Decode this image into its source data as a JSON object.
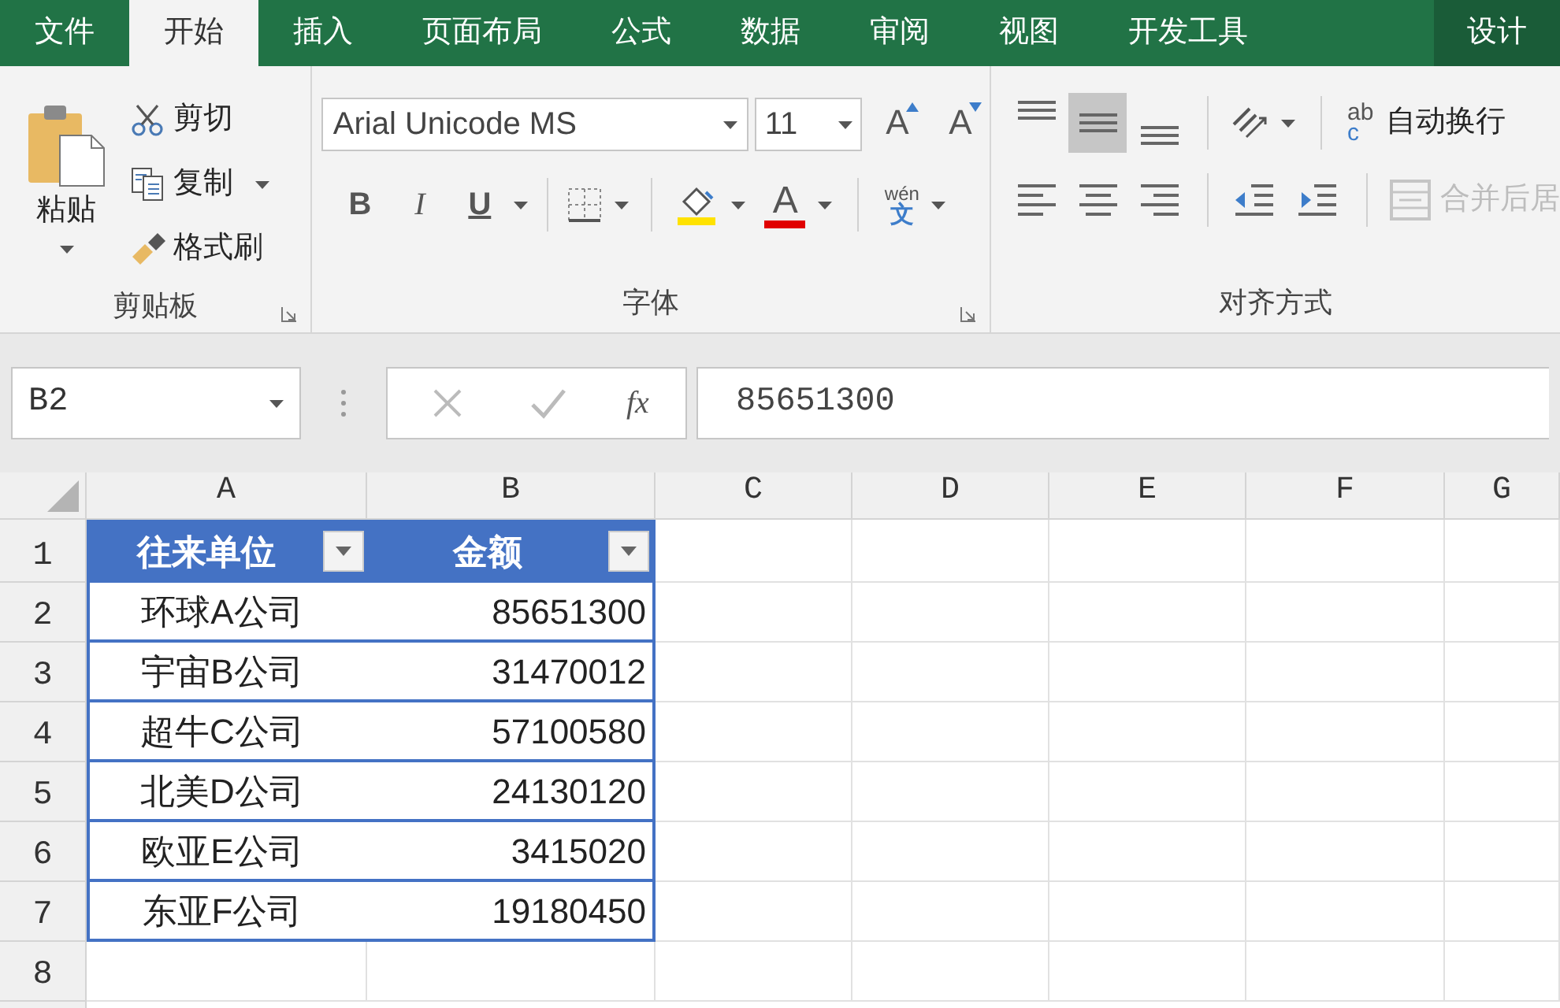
{
  "tabs": [
    {
      "label": "文件",
      "selected": false,
      "kind": "standard"
    },
    {
      "label": "开始",
      "selected": true,
      "kind": "standard"
    },
    {
      "label": "插入",
      "selected": false,
      "kind": "standard"
    },
    {
      "label": "页面布局",
      "selected": false,
      "kind": "standard"
    },
    {
      "label": "公式",
      "selected": false,
      "kind": "standard"
    },
    {
      "label": "数据",
      "selected": false,
      "kind": "standard"
    },
    {
      "label": "审阅",
      "selected": false,
      "kind": "standard"
    },
    {
      "label": "视图",
      "selected": false,
      "kind": "standard"
    },
    {
      "label": "开发工具",
      "selected": false,
      "kind": "standard"
    },
    {
      "label": "设计",
      "selected": false,
      "kind": "contextual"
    }
  ],
  "clipboard": {
    "paste": "粘贴",
    "commands": [
      {
        "label": "剪切",
        "kind": "cut"
      },
      {
        "label": "复制",
        "kind": "copy"
      },
      {
        "label": "格式刷",
        "kind": "painter"
      }
    ],
    "group_label": "剪贴板"
  },
  "font": {
    "font_name": "Arial Unicode MS",
    "font_size": "11",
    "grow_label": "A",
    "shrink_label": "A",
    "styles": [
      {
        "label": "B",
        "kind": "bold"
      },
      {
        "label": "I",
        "kind": "italic"
      },
      {
        "label": "U",
        "kind": "underline"
      }
    ],
    "font_color_label": "A",
    "phonetic_top": "wén",
    "phonetic_bottom": "文",
    "group_label": "字体"
  },
  "alignment": {
    "vertical": [
      {
        "kind": "top",
        "selected": false
      },
      {
        "kind": "middle",
        "selected": true
      },
      {
        "kind": "bottom",
        "selected": false
      }
    ],
    "horizontal": [
      {
        "kind": "left",
        "selected": false
      },
      {
        "kind": "center",
        "selected": false
      },
      {
        "kind": "right",
        "selected": false
      }
    ],
    "wrap_icon_top": "ab",
    "wrap_icon_bottom": "c",
    "wrap_text": "自动换行",
    "merge": {
      "label": "合并后居",
      "disabled": true
    },
    "group_label": "对齐方式"
  },
  "formula_bar": {
    "name_box": "B2",
    "cancel_disabled": true,
    "enter_disabled": true,
    "fx": "fx",
    "formula": "85651300"
  },
  "sheet": {
    "columns": [
      "A",
      "B",
      "C",
      "D",
      "E",
      "F",
      "G"
    ],
    "rows": [
      {
        "number": "1",
        "kind": "header",
        "cells": [
          "往来单位",
          "金额"
        ]
      },
      {
        "number": "2",
        "kind": "data",
        "cells": [
          "环球A公司",
          "85651300"
        ]
      },
      {
        "number": "3",
        "kind": "data",
        "cells": [
          "宇宙B公司",
          "31470012"
        ]
      },
      {
        "number": "4",
        "kind": "data",
        "cells": [
          "超牛C公司",
          "57100580"
        ]
      },
      {
        "number": "5",
        "kind": "data",
        "cells": [
          "北美D公司",
          "24130120"
        ]
      },
      {
        "number": "6",
        "kind": "data",
        "cells": [
          "欧亚E公司",
          "3415020"
        ]
      },
      {
        "number": "7",
        "kind": "data",
        "cells": [
          "东亚F公司",
          "19180450"
        ]
      },
      {
        "number": "8",
        "kind": "empty",
        "cells": []
      }
    ]
  }
}
